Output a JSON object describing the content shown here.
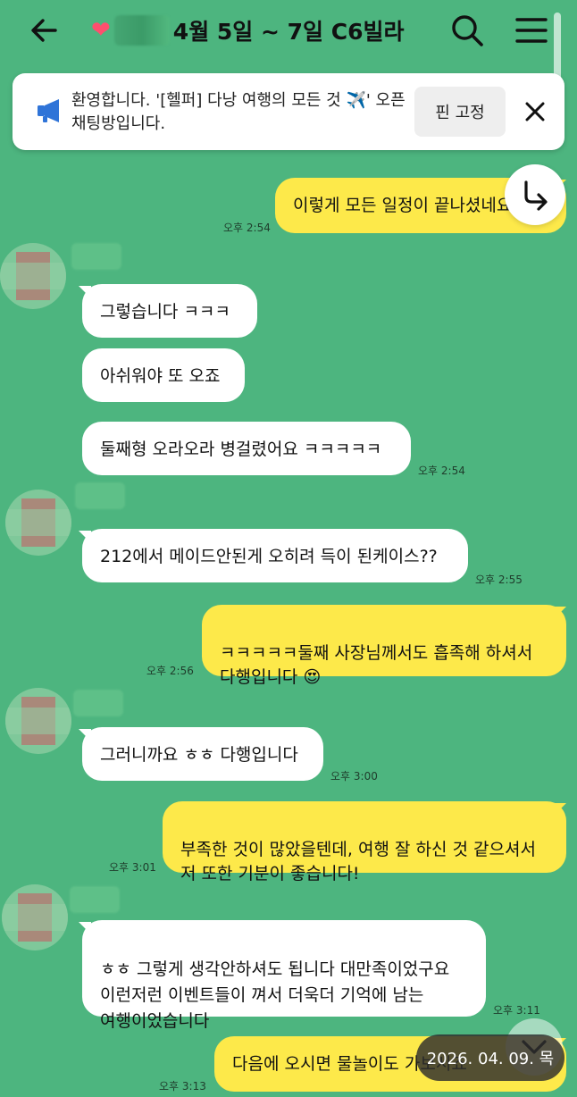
{
  "header": {
    "title_emoji": "❤",
    "title": "4월 5일 ~ 7일 C6빌라"
  },
  "notice": {
    "text": "환영합니다. '[헬퍼] 다낭 여행의 모든 것 ✈️' 오픈채팅방입니다.",
    "pin_label": "핀 고정"
  },
  "messages": [
    {
      "side": "out",
      "text": "이렇게 모든 일정이 끝나셨네요",
      "time": "오후 2:54"
    },
    {
      "side": "in",
      "text": "그렇습니다 ㅋㅋㅋ",
      "time": ""
    },
    {
      "side": "in",
      "text": "아쉬워야 또 오죠",
      "time": ""
    },
    {
      "side": "in",
      "text": "둘째형 오라오라 병걸렸어요 ㅋㅋㅋㅋㅋ",
      "time": "오후 2:54"
    },
    {
      "side": "in",
      "text": "212에서 메이드안된게 오히려 득이 된케이스??",
      "time": "오후 2:55"
    },
    {
      "side": "out",
      "text": "ㅋㅋㅋㅋㅋ둘째 사장님께서도 흡족해 하셔서\n다행입니다 😍",
      "time": "오후 2:56"
    },
    {
      "side": "in",
      "text": "그러니까요 ㅎㅎ 다행입니다",
      "time": "오후 3:00"
    },
    {
      "side": "out",
      "text": "부족한 것이 많았을텐데, 여행 잘 하신 것 같으셔서\n저 또한 기분이 좋습니다!",
      "time": "오후 3:01"
    },
    {
      "side": "in",
      "text": "ㅎㅎ 그렇게 생각안하셔도 됩니다 대만족이었구요\n이런저런 이벤트들이 껴서 더욱더 기억에 남는\n여행이었습니다",
      "time": "오후 3:11"
    },
    {
      "side": "out",
      "text": "다음에 오시면 물놀이도 가보시죠",
      "time": "오후 3:13"
    }
  ],
  "date_overlay": "2026. 04. 09. 목",
  "colors": {
    "background": "#4db57f",
    "outgoing": "#fde94a",
    "incoming": "#ffffff"
  }
}
